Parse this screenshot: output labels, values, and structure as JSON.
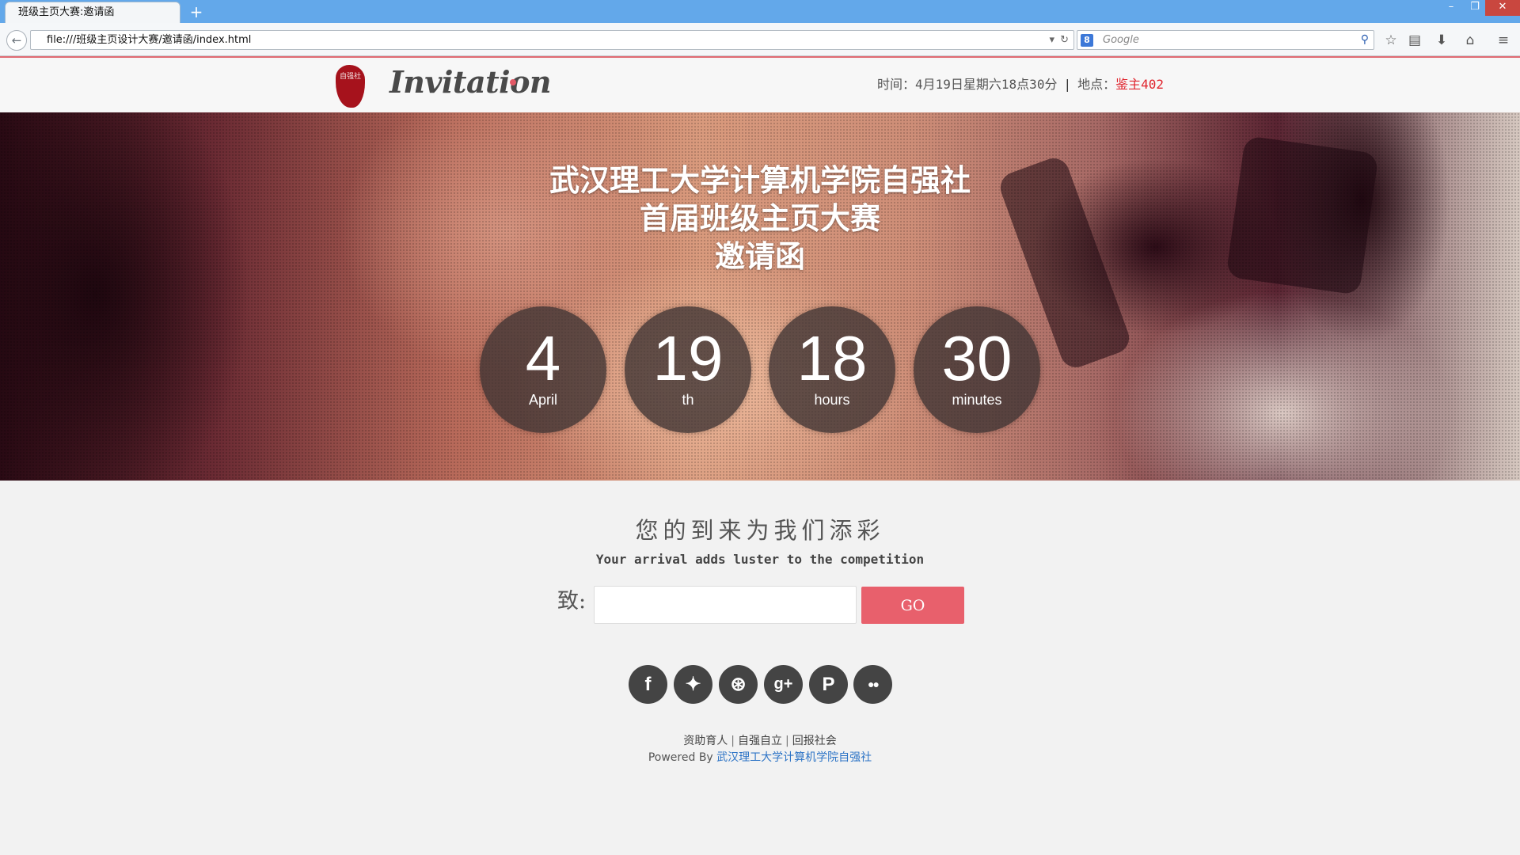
{
  "browser": {
    "tab_title": "班级主页大赛:邀请函",
    "new_tab_icon": "+",
    "url": "file:///班级主页设计大赛/邀请函/index.html",
    "search_engine_icon": "8",
    "search_placeholder": "Google",
    "window_controls": {
      "minimize": "–",
      "restore": "❐",
      "close": "✕"
    },
    "icons": {
      "back": "←",
      "dropdown": "▾",
      "reload": "↻",
      "search_go": "⚲",
      "bookmark": "☆",
      "reader": "▤",
      "download": "⬇",
      "home": "⌂",
      "menu": "≡"
    }
  },
  "header": {
    "logo_seal_text": "自强社",
    "logo_text": "Invitation",
    "time_label": "时间：",
    "time_value": "4月19日星期六18点30分",
    "separator": "|",
    "place_label": "地点：",
    "place_value": "鉴主402"
  },
  "hero": {
    "title_lines": [
      "武汉理工大学计算机学院自强社",
      "首届班级主页大赛",
      "邀请函"
    ],
    "countdown": [
      {
        "num": "4",
        "unit": "April"
      },
      {
        "num": "19",
        "unit": "th"
      },
      {
        "num": "18",
        "unit": "hours"
      },
      {
        "num": "30",
        "unit": "minutes"
      }
    ]
  },
  "invite": {
    "tagline": "您的到来为我们添彩",
    "subtag": "Your arrival adds luster to the competition",
    "to_label": "致:",
    "name_value": "",
    "go_label": "GO"
  },
  "social": [
    {
      "name": "facebook",
      "glyph": "f"
    },
    {
      "name": "twitter",
      "glyph": "✦"
    },
    {
      "name": "dribbble",
      "glyph": "⊛"
    },
    {
      "name": "google-plus",
      "glyph": "g+"
    },
    {
      "name": "pinterest",
      "glyph": "P"
    },
    {
      "name": "flickr",
      "glyph": "●●"
    }
  ],
  "footer": {
    "links": [
      "资助育人",
      "自强自立",
      "回报社会"
    ],
    "divider": "|",
    "powered_prefix": "Powered By ",
    "powered_link": "武汉理工大学计算机学院自强社"
  },
  "colors": {
    "accent": "#e8606c",
    "place_text": "#e0232c",
    "link": "#2d74c6"
  }
}
